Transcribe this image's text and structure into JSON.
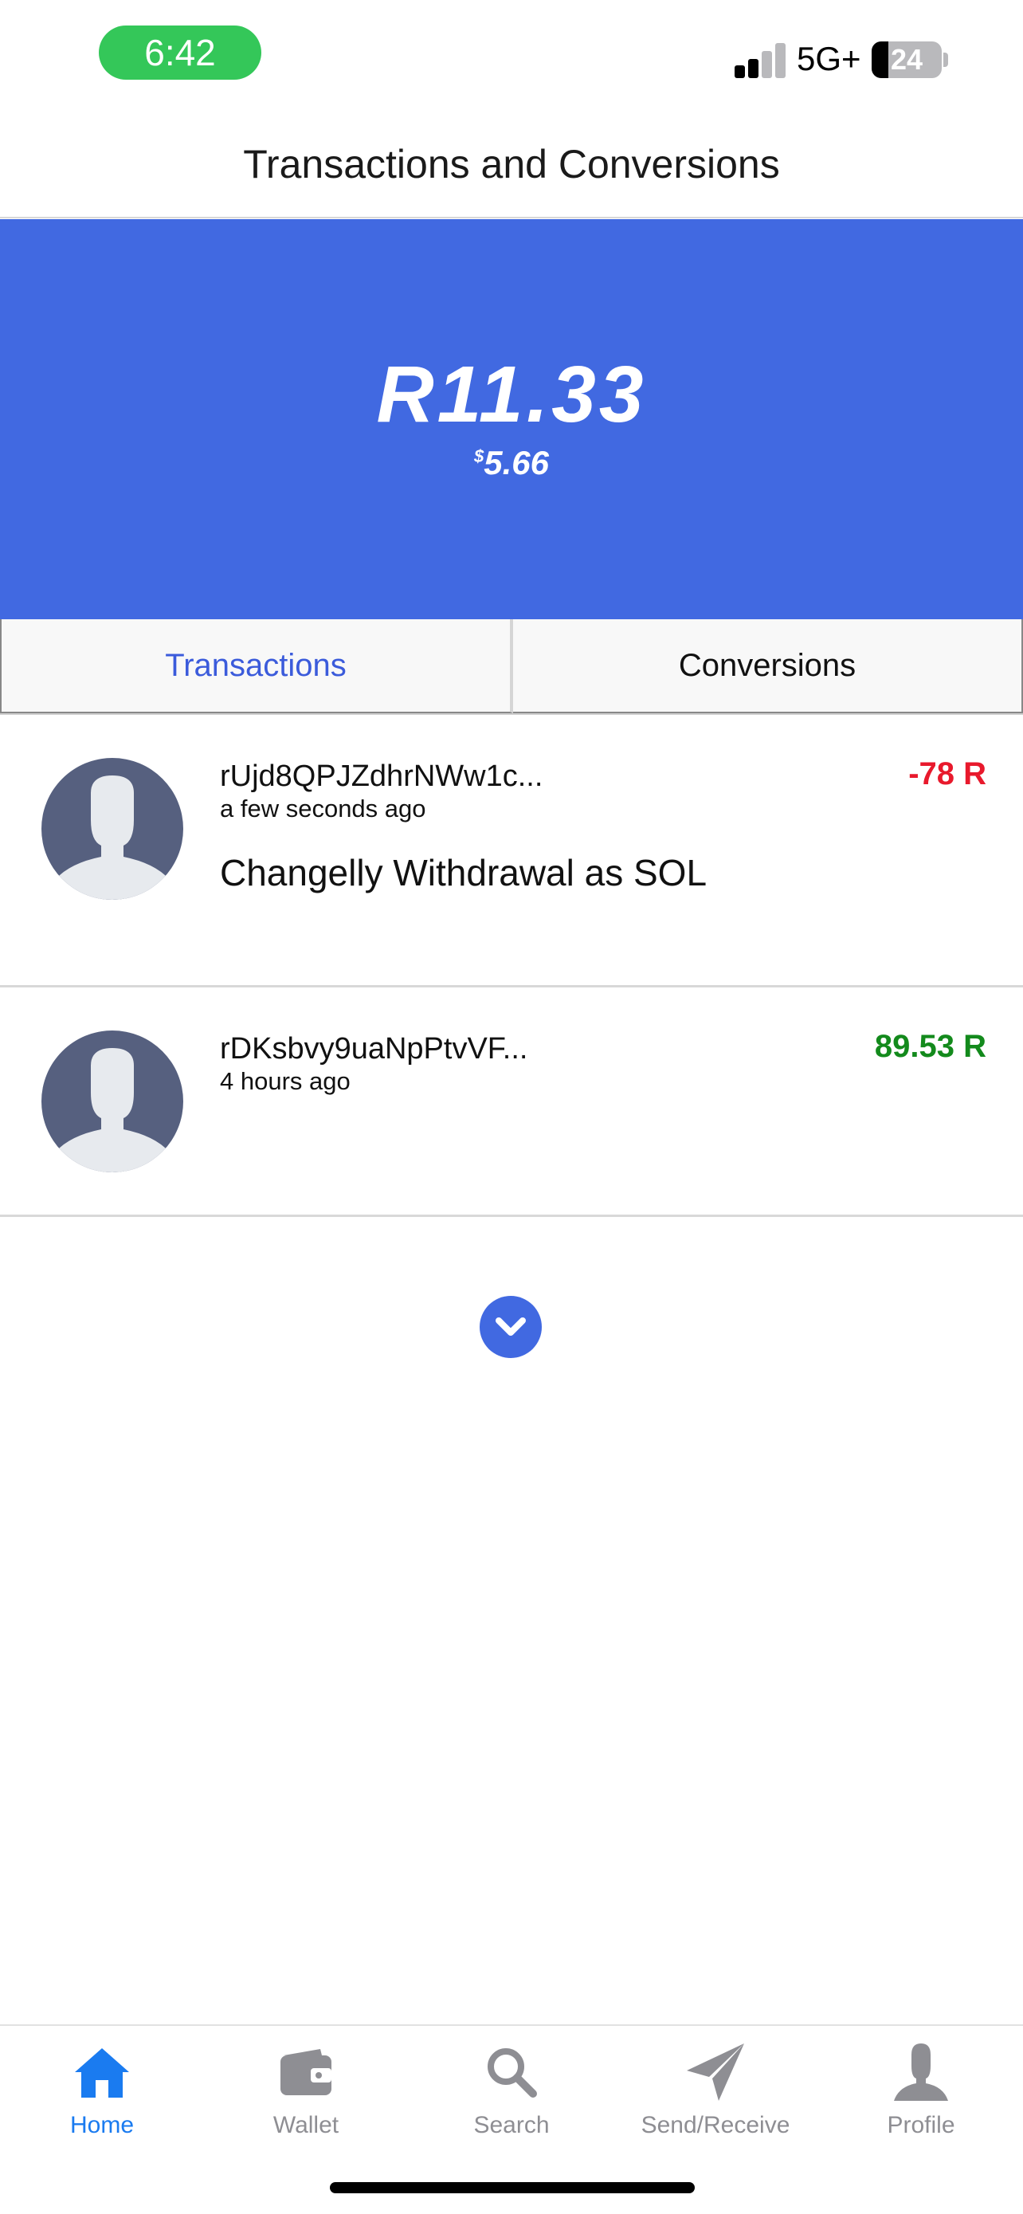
{
  "status_bar": {
    "time": "6:42",
    "network": "5G+",
    "battery": "24"
  },
  "header": {
    "title": "Transactions and Conversions"
  },
  "balance": {
    "amount": "R11.33",
    "usd_symbol": "$",
    "usd": "5.66"
  },
  "tabs": [
    {
      "label": "Transactions",
      "active": true
    },
    {
      "label": "Conversions",
      "active": false
    }
  ],
  "transactions": [
    {
      "address": "rUjd8QPJZdhrNWw1c...",
      "time_ago": "a few seconds ago",
      "memo": "Changelly Withdrawal as SOL",
      "amount": "-78 R"
    },
    {
      "address": "rDKsbvy9uaNpPtvVF...",
      "time_ago": "4 hours ago",
      "memo": "",
      "amount": "89.53 R"
    }
  ],
  "nav": [
    {
      "label": "Home",
      "icon": "home-icon",
      "active": true
    },
    {
      "label": "Wallet",
      "icon": "wallet-icon",
      "active": false
    },
    {
      "label": "Search",
      "icon": "search-icon",
      "active": false
    },
    {
      "label": "Send/Receive",
      "icon": "paper-plane-icon",
      "active": false
    },
    {
      "label": "Profile",
      "icon": "person-icon",
      "active": false
    }
  ],
  "colors": {
    "brand_blue": "#4169e1",
    "tab_active": "#3b5bdb",
    "negative": "#e8192c",
    "positive": "#138a1c",
    "nav_active": "#1a7bf0",
    "nav_inactive": "#8e8e93"
  }
}
